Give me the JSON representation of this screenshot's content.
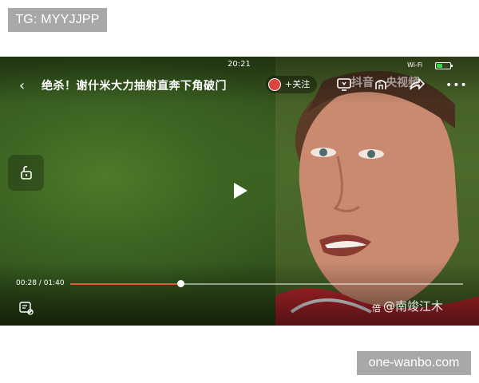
{
  "overlays": {
    "top_watermark": "TG: MYYJJPP",
    "bottom_watermark": "one-wanbo.com"
  },
  "status_bar": {
    "time": "20:21",
    "wifi": "Wi-Fi"
  },
  "header": {
    "title": "绝杀！谢什米大力抽射直奔下角破门",
    "follow_label": "+关注",
    "app_watermark": "抖音 · 央视频"
  },
  "player": {
    "current_time": "00:28",
    "duration": "01:40",
    "time_display": "00:28 / 01:40",
    "progress_fraction": 0.28,
    "speed_label": "倍",
    "author_watermark": "@南竣江木"
  },
  "colors": {
    "progress": "#e25a3a",
    "battery": "#36d34f"
  },
  "icons": [
    "back-icon",
    "tv-cast-icon",
    "favorite-icon",
    "share-icon",
    "more-icon",
    "lock-icon",
    "play-icon",
    "danmaku-icon"
  ]
}
